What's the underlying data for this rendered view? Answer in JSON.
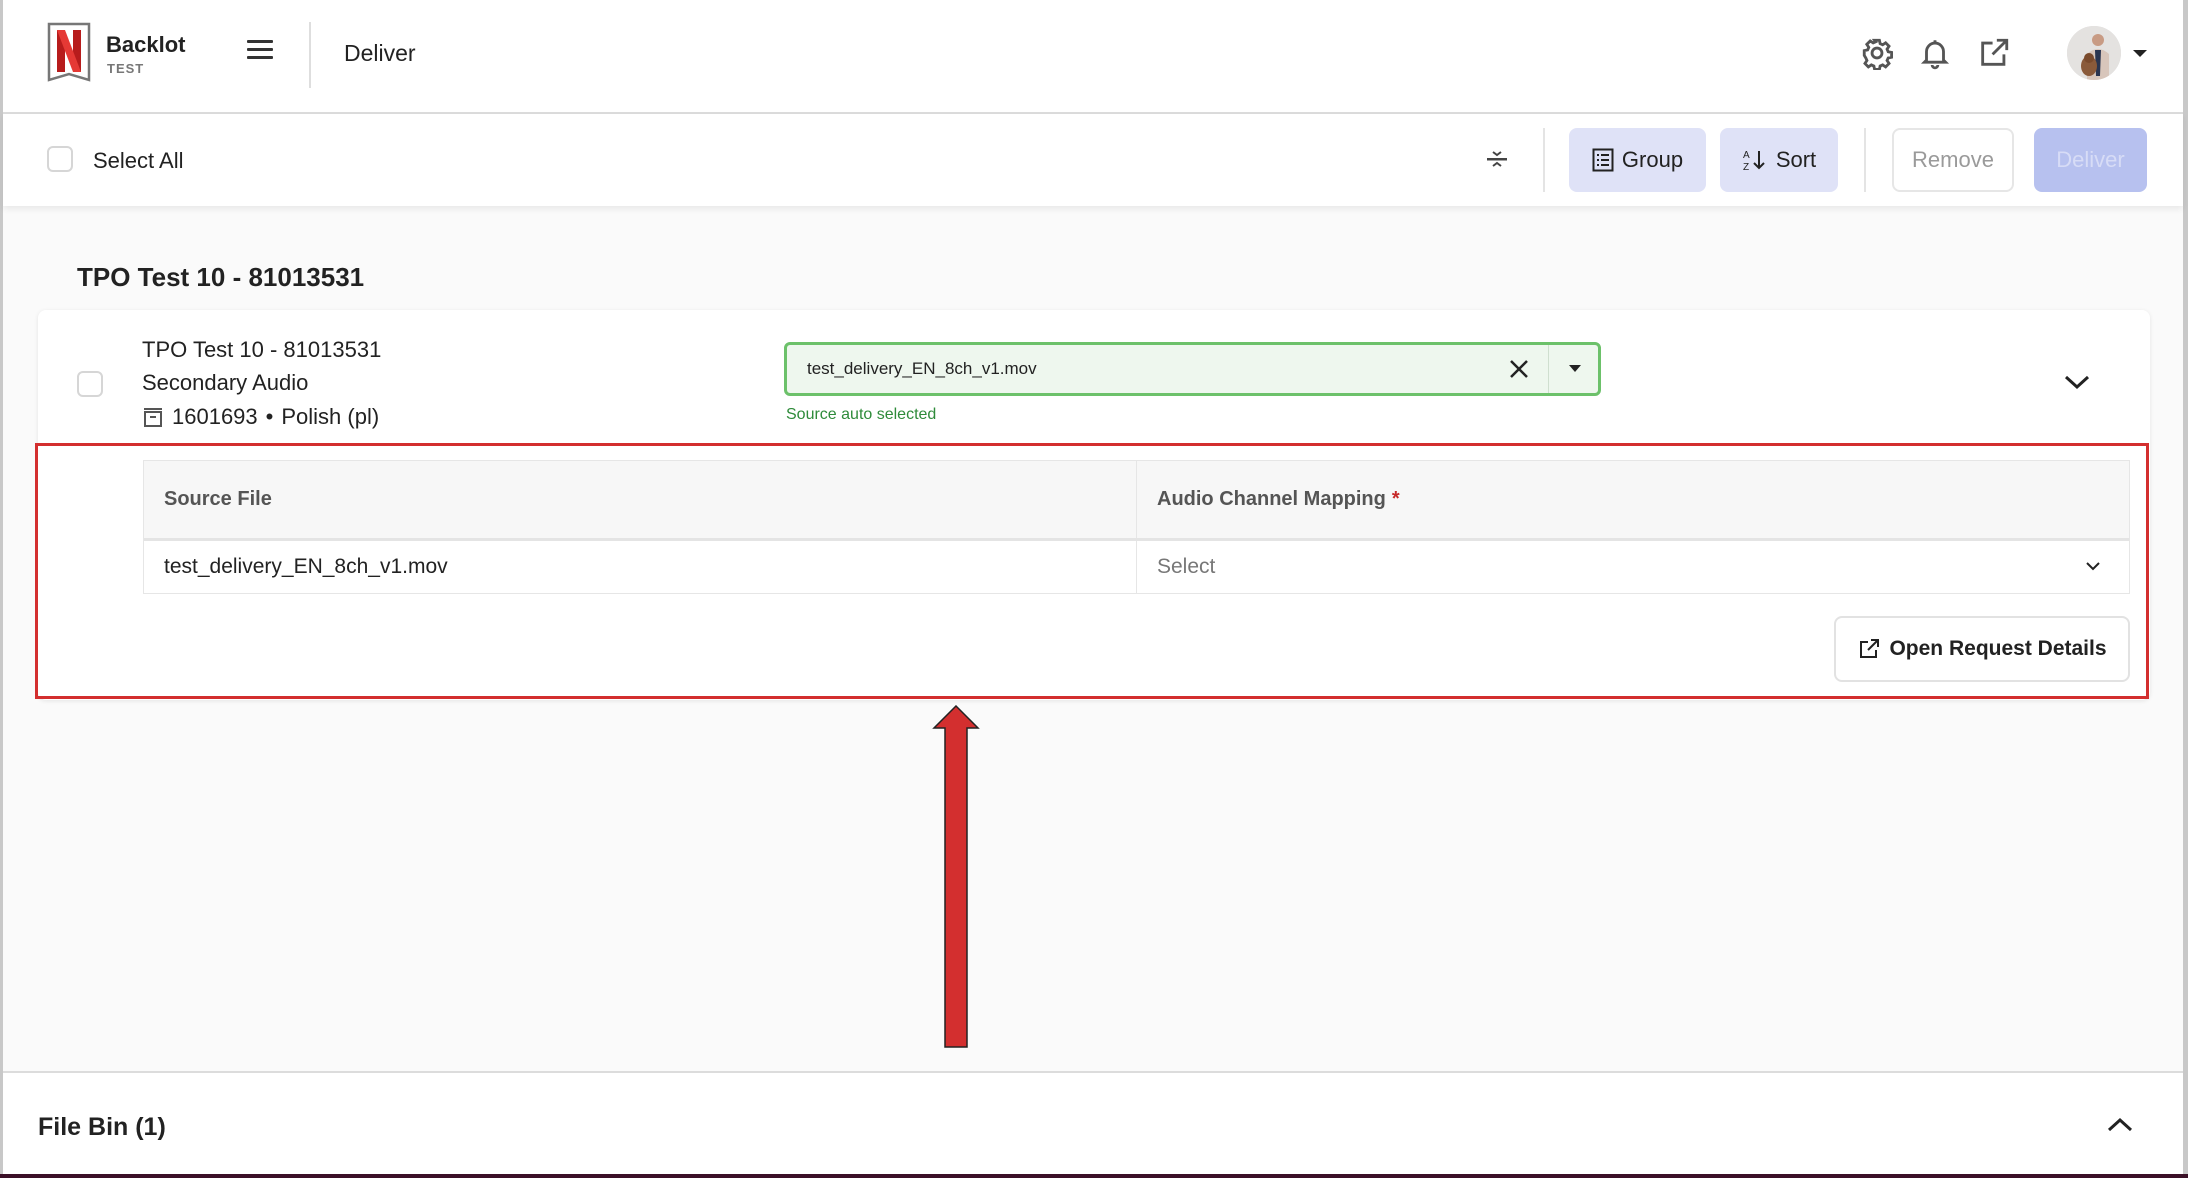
{
  "app": {
    "brand_name": "Backlot",
    "environment": "TEST",
    "page_title": "Deliver"
  },
  "header": {
    "icons": [
      "settings-icon",
      "notifications-icon",
      "external-link-icon"
    ],
    "avatar_alt": "User avatar"
  },
  "toolbar": {
    "select_all_label": "Select All",
    "select_all_checked": false,
    "group_label": "Group",
    "sort_label": "Sort",
    "sort_icon_text": "A↓Z",
    "remove_label": "Remove",
    "deliver_label": "Deliver"
  },
  "group": {
    "title": "TPO Test 10 - 81013531",
    "items": [
      {
        "title": "TPO Test 10 - 81013531",
        "type": "Secondary Audio",
        "id": "1601693",
        "separator": "•",
        "language": "Polish (pl)",
        "checked": false,
        "source_file": "test_delivery_EN_8ch_v1.mov",
        "source_hint": "Source auto selected",
        "mapping_table": {
          "columns": [
            "Source File",
            "Audio Channel Mapping"
          ],
          "required_marker": "*",
          "rows": [
            {
              "source_file": "test_delivery_EN_8ch_v1.mov",
              "mapping_placeholder": "Select"
            }
          ]
        },
        "open_details_label": "Open Request Details"
      }
    ]
  },
  "file_bin": {
    "title": "File Bin (1)"
  },
  "colors": {
    "accent_soft": "#dfe2f7",
    "deliver_disabled": "#b7c1ef",
    "success_border": "#6cc16a",
    "success_bg": "#eef7ee",
    "success_text": "#2e8b3a",
    "annotation_red": "#d32f2f",
    "brand_red": "#d32f2f"
  }
}
